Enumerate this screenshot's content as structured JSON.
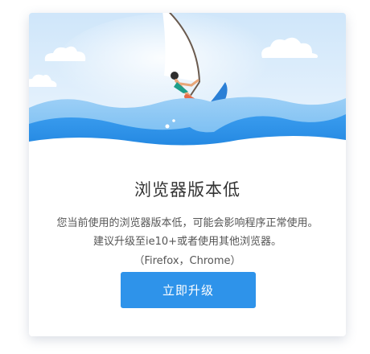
{
  "dialog": {
    "title": "浏览器版本低",
    "message_line1": "您当前使用的浏览器版本低，可能会影响程序正常使用。",
    "message_line2": "建议升级至ie10+或者使用其他浏览器。",
    "message_line3": "（Firefox，Chrome）",
    "upgrade_button_label": "立即升级"
  },
  "colors": {
    "accent": "#2e93ea",
    "sky": "#d8ecfb",
    "wave": "#2a8fe6",
    "title_text": "#333333",
    "body_text": "#555555"
  },
  "illustration": {
    "icons": [
      "cloud-icon",
      "sailboat-icon",
      "windsurfer-icon",
      "wave-icon"
    ]
  }
}
